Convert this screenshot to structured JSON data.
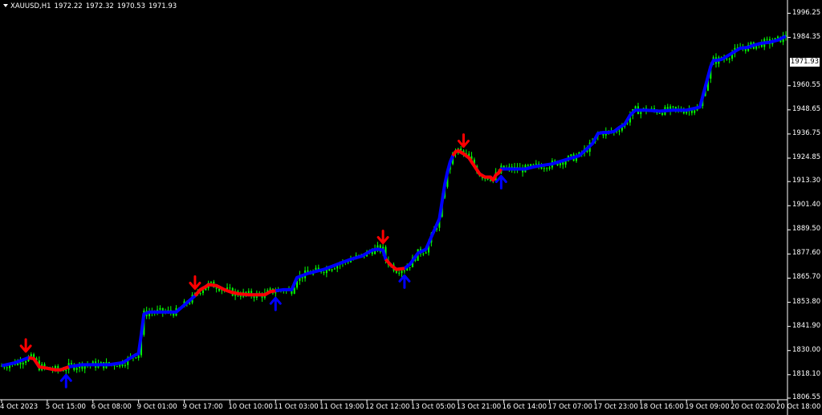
{
  "header": {
    "symbol": "XAUUSD,H1",
    "open": "1972.22",
    "high": "1972.32",
    "low": "1970.53",
    "close": "1971.93"
  },
  "current_price_label": "1971.93",
  "colors": {
    "background": "#000000",
    "candles": "#00ff00",
    "trend_up": "#0000ff",
    "trend_down": "#ff0000",
    "axis": "#ffffff"
  },
  "chart_data": {
    "type": "line",
    "title": "",
    "xlabel": "",
    "ylabel": "",
    "ylim": [
      1806.55,
      2002
    ],
    "grid": false,
    "y_ticks": [
      "1996.25",
      "1984.35",
      "1960.55",
      "1948.65",
      "1936.75",
      "1924.85",
      "1913.30",
      "1901.40",
      "1889.50",
      "1877.60",
      "1865.70",
      "1853.80",
      "1841.90",
      "1830.00",
      "1818.10",
      "1806.55"
    ],
    "x_ticks": [
      "4 Oct 2023",
      "5 Oct 15:00",
      "6 Oct 08:00",
      "9 Oct 01:00",
      "9 Oct 17:00",
      "10 Oct 10:00",
      "11 Oct 03:00",
      "11 Oct 19:00",
      "12 Oct 12:00",
      "13 Oct 05:00",
      "13 Oct 21:00",
      "16 Oct 14:00",
      "17 Oct 07:00",
      "17 Oct 23:00",
      "18 Oct 16:00",
      "19 Oct 09:00",
      "20 Oct 02:00",
      "20 Oct 18:00"
    ],
    "x_positions": [
      0,
      17,
      34,
      51,
      68,
      85,
      102,
      119,
      136,
      153,
      170,
      187,
      204,
      221,
      238,
      255,
      272,
      289
    ],
    "x_domain": [
      0,
      292
    ],
    "series": [
      {
        "role": "trend-line",
        "x": [
          0,
          5,
          8,
          10,
          12,
          14,
          20,
          22,
          25,
          30,
          40,
          45,
          50,
          51,
          52,
          53,
          55,
          60,
          65,
          72,
          74,
          76,
          77,
          80,
          83,
          85,
          88,
          92,
          98,
          100,
          102,
          105,
          108,
          110,
          114,
          120,
          126,
          130,
          134,
          138,
          140,
          142,
          143,
          145,
          147,
          150,
          152,
          155,
          158,
          160,
          163,
          165,
          166,
          167,
          168,
          169,
          170,
          172,
          174,
          176,
          178,
          180,
          182,
          183,
          184,
          185,
          186,
          188,
          190,
          192,
          195,
          198,
          200,
          205,
          210,
          215,
          220,
          222,
          224,
          226,
          228,
          230,
          232,
          234,
          236,
          238,
          240,
          245,
          250,
          255,
          260,
          262,
          264,
          265,
          266,
          268,
          270,
          275,
          278,
          280,
          283,
          286,
          289,
          292
        ],
        "y": [
          1822.5,
          1824.0,
          1825.5,
          1826.5,
          1826.0,
          1822.0,
          1820.5,
          1820.5,
          1822.0,
          1823.0,
          1823.0,
          1824.0,
          1828.0,
          1828.5,
          1838.0,
          1848.0,
          1849.0,
          1849.0,
          1849.0,
          1857.0,
          1860.0,
          1861.5,
          1862.5,
          1862.0,
          1860.0,
          1859.0,
          1858.0,
          1857.5,
          1857.5,
          1859.0,
          1859.5,
          1860.0,
          1860.0,
          1866.0,
          1868.0,
          1870.0,
          1873.0,
          1875.0,
          1876.5,
          1879.5,
          1880.0,
          1879.5,
          1875.0,
          1872.0,
          1870.0,
          1870.5,
          1872.5,
          1878.0,
          1880.0,
          1886.0,
          1895.0,
          1912.0,
          1918.0,
          1923.0,
          1926.0,
          1928.0,
          1928.5,
          1927.0,
          1925.0,
          1921.0,
          1917.0,
          1915.5,
          1915.5,
          1914.0,
          1916.5,
          1917.5,
          1919.5,
          1919.5,
          1919.5,
          1919.5,
          1919.5,
          1920.5,
          1921.0,
          1922.0,
          1924.0,
          1926.0,
          1932.0,
          1937.0,
          1937.5,
          1937.5,
          1938.0,
          1940.0,
          1941.5,
          1946.0,
          1948.5,
          1948.5,
          1948.5,
          1948.0,
          1948.5,
          1948.5,
          1950.0,
          1960.0,
          1970.0,
          1973.0,
          1973.0,
          1973.5,
          1975.0,
          1979.0,
          1979.5,
          1980.5,
          1981.5,
          1982.0,
          1983.0,
          1985.0
        ],
        "down_segments": [
          [
            10,
            25
          ],
          [
            72,
            102
          ],
          [
            143,
            150
          ],
          [
            168,
            186
          ]
        ]
      }
    ],
    "signals": [
      {
        "type": "sell",
        "x": 9
      },
      {
        "type": "buy",
        "x": 24
      },
      {
        "type": "sell",
        "x": 72
      },
      {
        "type": "buy",
        "x": 102
      },
      {
        "type": "sell",
        "x": 142
      },
      {
        "type": "buy",
        "x": 150
      },
      {
        "type": "sell",
        "x": 172
      },
      {
        "type": "buy",
        "x": 186
      }
    ]
  }
}
